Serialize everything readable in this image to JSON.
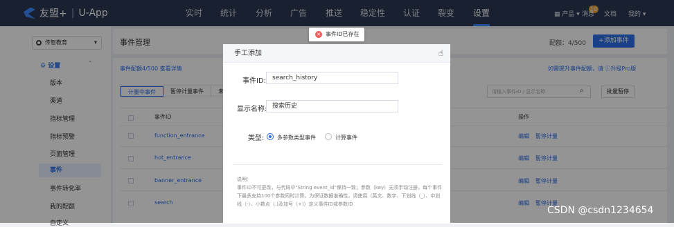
{
  "topbar": {
    "brand": "友盟+",
    "product": "U-App",
    "nav": [
      "实时",
      "统计",
      "分析",
      "广告",
      "推送",
      "稳定性",
      "认证",
      "裂变",
      "设置"
    ],
    "active_nav": "设置",
    "products_label": "产品",
    "messages_label": "消息",
    "messages_count": "10",
    "docs_label": "文档",
    "me_label": "我的"
  },
  "sidebar": {
    "app_name": "传智教育",
    "section": "设置",
    "items": [
      "版本",
      "渠道",
      "指标管理",
      "指标预警",
      "页面管理",
      "事件",
      "事件转化率",
      "我的配额",
      "自定义"
    ],
    "active_item": "事件"
  },
  "main": {
    "title": "事件管理",
    "quota": "配额：4/500",
    "add_button": "+添加事件",
    "quota_info": "事件配额4/500  查看详情",
    "upgrade_text": "如需提升事件配额，请 ⓘ升级Pro版",
    "tabs": [
      "计量中事件",
      "暂停计量事件",
      "未注"
    ],
    "search_placeholder": "请输入事件ID / 显示名称",
    "batch_button": "批量暂停",
    "col_event_id": "事件ID",
    "col_action": "操作",
    "rows": [
      {
        "id": "function_entrance",
        "edit": "编辑",
        "pause": "暂停计量"
      },
      {
        "id": "hot_entrance",
        "edit": "编辑",
        "pause": "暂停计量"
      },
      {
        "id": "banner_entrance",
        "edit": "编辑",
        "pause": "暂停计量"
      },
      {
        "id": "search",
        "edit": "编辑",
        "pause": "暂停计量"
      }
    ]
  },
  "toast": {
    "message": "事件ID已存在"
  },
  "modal": {
    "title": "手工添加",
    "event_id_label": "事件ID:",
    "event_id_value": "search_history",
    "display_name_label": "显示名称:",
    "display_name_value": "搜索历史",
    "type_label": "类型:",
    "type_options": [
      "多参数类型事件",
      "计算事件"
    ],
    "type_selected": "多参数类型事件",
    "note_title": "说明：",
    "note_text": "事件ID不可更改，与代码中\"String event_id\"保持一致；参数（key）无须手动注册，每个事件下最多支持100个参数同时计算。为保证数据准确性，请使用（英文、数字、下划线（_）、中划线（-）、小数点（.)及加号（+)）定义事件ID或参数ID"
  },
  "watermark": "CSDN @csdn1234654"
}
